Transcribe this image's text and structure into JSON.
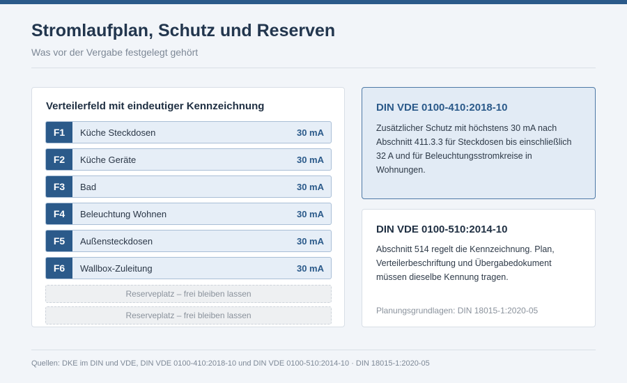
{
  "header": {
    "title": "Stromlaufplan, Schutz und Reserven",
    "subtitle": "Was vor der Vergabe festgelegt gehört"
  },
  "panel": {
    "title": "Verteilerfeld mit eindeutiger Kennzeichnung",
    "breakers": [
      {
        "code": "F1",
        "name": "Küche Steckdosen",
        "rating": "30 mA"
      },
      {
        "code": "F2",
        "name": "Küche Geräte",
        "rating": "30 mA"
      },
      {
        "code": "F3",
        "name": "Bad",
        "rating": "30 mA"
      },
      {
        "code": "F4",
        "name": "Beleuchtung Wohnen",
        "rating": "30 mA"
      },
      {
        "code": "F5",
        "name": "Außensteckdosen",
        "rating": "30 mA"
      },
      {
        "code": "F6",
        "name": "Wallbox-Zuleitung",
        "rating": "30 mA"
      }
    ],
    "reserves": [
      "Reserveplatz – frei bleiben lassen",
      "Reserveplatz – frei bleiben lassen"
    ]
  },
  "cards": [
    {
      "title": "DIN VDE 0100-410:2018-10",
      "text": "Zusätzlicher Schutz mit höchstens 30 mA nach Abschnitt 411.3.3 für Steckdosen bis einschließlich 32 A und für Beleuchtungsstromkreise in Wohnungen."
    },
    {
      "title": "DIN VDE 0100-510:2014-10",
      "text": "Abschnitt 514 regelt die Kennzeichnung. Plan, Verteilerbeschriftung und Übergabedokument müssen dieselbe Kennung tragen.",
      "note": "Planungsgrundlagen: DIN 18015-1:2020-05"
    }
  ],
  "footer": {
    "sources": "Quellen: DKE im DIN und VDE, DIN VDE 0100-410:2018-10 und DIN VDE 0100-510:2014-10 · DIN 18015-1:2020-05"
  },
  "colors": {
    "accent": "#2b5a8a",
    "background": "#f2f5f9",
    "highlight_card": "#e2ebf5"
  }
}
